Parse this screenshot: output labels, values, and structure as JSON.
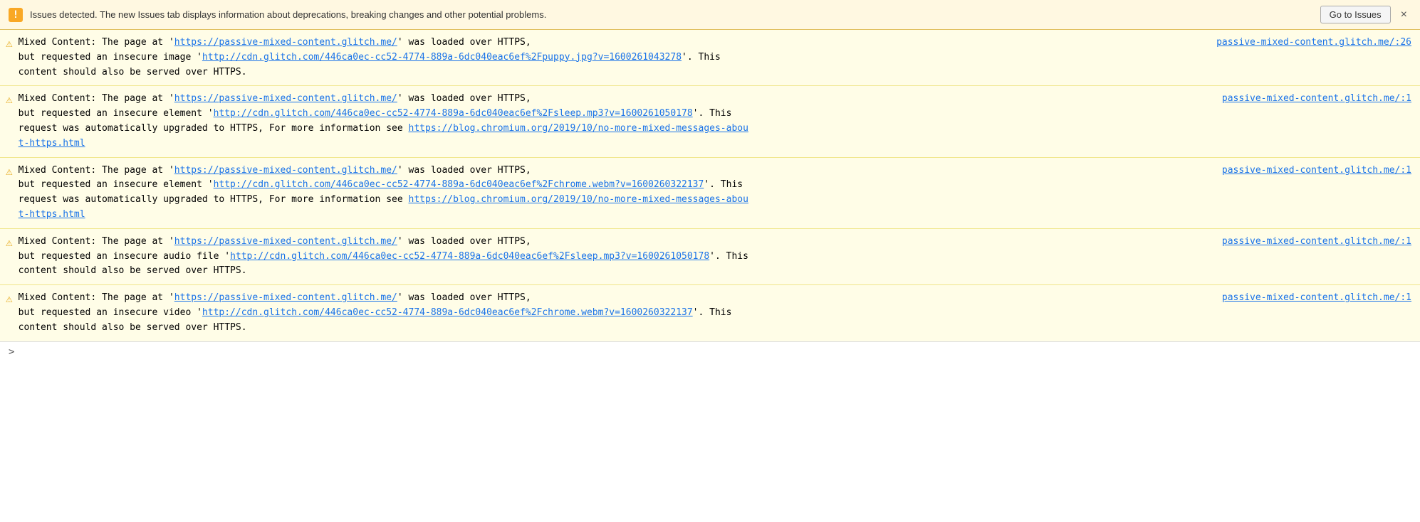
{
  "banner": {
    "icon": "!",
    "text": "Issues detected. The new Issues tab displays information about deprecations, breaking changes and other potential problems.",
    "button_label": "Go to Issues",
    "close_label": "×"
  },
  "messages": [
    {
      "id": 1,
      "source_location": "passive-mixed-content.glitch.me/:26",
      "line1": "Mixed Content: The page at 'https://passive-mixed-content.glitch.me/' was loaded over HTTPS,",
      "line2_pre": "but requested an insecure image '",
      "line2_link": "http://cdn.glitch.com/446ca0ec-cc52-4774-889a-6dc040eac6ef%2Fpuppy.jpg?v=1600261043278",
      "line2_post": "'. This",
      "line3": "content should also be served over HTTPS.",
      "extra_link": null
    },
    {
      "id": 2,
      "source_location": "passive-mixed-content.glitch.me/:1",
      "line1": "Mixed Content: The page at 'https://passive-mixed-content.glitch.me/' was loaded over HTTPS,",
      "line2_pre": "but requested an insecure element '",
      "line2_link": "http://cdn.glitch.com/446ca0ec-cc52-4774-889a-6dc040eac6ef%2Fsleep.mp3?v=1600261050178",
      "line2_post": "'. This",
      "line3_pre": "request was automatically upgraded to HTTPS, For more information see ",
      "line3_link": "https://blog.chromium.org/2019/10/no-more-mixed-messages-about-https.html",
      "line3_link_text": "https://blog.chromium.org/2019/10/no-more-mixed-messages-abou\nt-https.html",
      "extra_link": true
    },
    {
      "id": 3,
      "source_location": "passive-mixed-content.glitch.me/:1",
      "line1": "Mixed Content: The page at 'https://passive-mixed-content.glitch.me/' was loaded over HTTPS,",
      "line2_pre": "but requested an insecure element '",
      "line2_link": "http://cdn.glitch.com/446ca0ec-cc52-4774-889a-6dc040eac6ef%2Fchrome.webm?v=1600260322137",
      "line2_post": "'. This",
      "line3_pre": "request was automatically upgraded to HTTPS, For more information see ",
      "line3_link": "https://blog.chromium.org/2019/10/no-more-mixed-messages-about-https.html",
      "line3_link_text": "https://blog.chromium.org/2019/10/no-more-mixed-messages-abou\nt-https.html",
      "extra_link": true
    },
    {
      "id": 4,
      "source_location": "passive-mixed-content.glitch.me/:1",
      "line1": "Mixed Content: The page at 'https://passive-mixed-content.glitch.me/' was loaded over HTTPS,",
      "line2_pre": "but requested an insecure audio file '",
      "line2_link": "http://cdn.glitch.com/446ca0ec-cc52-4774-889a-6dc040eac6ef%2Fsleep.mp3?v=1600261050178",
      "line2_post": "'. This",
      "line3": "content should also be served over HTTPS.",
      "extra_link": null
    },
    {
      "id": 5,
      "source_location": "passive-mixed-content.glitch.me/:1",
      "line1": "Mixed Content: The page at 'https://passive-mixed-content.glitch.me/' was loaded over HTTPS,",
      "line2_pre": "but requested an insecure video '",
      "line2_link": "http://cdn.glitch.com/446ca0ec-cc52-4774-889a-6dc040eac6ef%2Fchrome.webm?v=1600260322137",
      "line2_post": "'. This",
      "line3": "content should also be served over HTTPS.",
      "extra_link": null
    }
  ],
  "footer": {
    "chevron": ">"
  },
  "colors": {
    "link": "#1a73e8",
    "warning_bg": "#fffde7",
    "banner_bg": "#fff8e1"
  }
}
